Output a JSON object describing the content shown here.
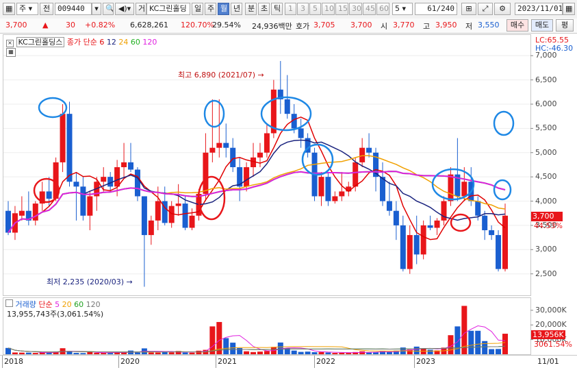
{
  "toolbar": {
    "type_select": "주",
    "prev_label": "전",
    "code_value": "009440",
    "order_btn": "거",
    "stock_name": "KC그린홀딩",
    "period_tabs": [
      "일",
      "주",
      "월",
      "년",
      "분",
      "초",
      "틱"
    ],
    "selected_period": "월",
    "interval_buttons": [
      "1",
      "3",
      "5",
      "10",
      "15",
      "30",
      "45",
      "60"
    ],
    "interval_select": "5",
    "count_current": "61",
    "count_total": "/240",
    "date_value": "2023/11/01"
  },
  "quote": {
    "price": "3,700",
    "change": "30",
    "change_pct": "+0.82%",
    "volume": "6,628,261",
    "vol_ratio": "120.70%",
    "turnover": "29.54%",
    "amount": "24,936백만",
    "bid_label": "호가",
    "bid1": "3,705",
    "bid2": "3,700",
    "open_label": "시",
    "open": "3,770",
    "high_label": "고",
    "high": "3,950",
    "low_label": "저",
    "low": "3,550",
    "buy_btn": "매수",
    "sell_btn": "매도",
    "eval_btn": "평"
  },
  "legend": {
    "name": "KC그린홀딩스",
    "ma_label": "종가 단순",
    "ma_periods": [
      "6",
      "12",
      "24",
      "60",
      "120"
    ],
    "lc": "LC:65.55",
    "hc": "HC:-46.30"
  },
  "annotations": {
    "high": "최고 6,890 (2021/07)",
    "low": "최저 2,235 (2020/03)",
    "last_price": "3,700",
    "last_pct": "44.53%"
  },
  "price_axis": [
    "7,000",
    "6,500",
    "6,000",
    "5,500",
    "5,000",
    "4,500",
    "4,000",
    "3,500",
    "3,000",
    "2,500"
  ],
  "volume_panel": {
    "title": "거래량",
    "ma_label": "단순",
    "ma_periods": [
      "5",
      "20",
      "60",
      "120"
    ],
    "info": "13,955,743주(3,061.54%)",
    "axis": [
      "30,000K",
      "20,000K",
      "10,000K"
    ],
    "last": "13,956K",
    "last_pct": "3061.54%"
  },
  "time_axis": [
    "2018",
    "2020",
    "2021",
    "2022",
    "2023",
    "11/01"
  ],
  "colors": {
    "up": "#e8161a",
    "down": "#1a5fd0",
    "ma6": "#e00000",
    "ma12": "#1a237e",
    "ma24": "#f0a000",
    "ma60": "#20d020",
    "ma120": "#e020e0",
    "marker_blue": "#1e88e5",
    "marker_red": "#e8161a"
  },
  "chart_data": {
    "type": "candlestick",
    "interval": "monthly",
    "y_unit": "KRW",
    "ylim": [
      2100,
      7300
    ],
    "candles": [
      {
        "d": "2017-06",
        "o": 3800,
        "h": 4000,
        "l": 3300,
        "c": 3350
      },
      {
        "d": "2017-07",
        "o": 3350,
        "h": 3900,
        "l": 3200,
        "c": 3750
      },
      {
        "d": "2017-08",
        "o": 3700,
        "h": 4100,
        "l": 3600,
        "c": 3800
      },
      {
        "d": "2017-09",
        "o": 3800,
        "h": 4200,
        "l": 3500,
        "c": 3600
      },
      {
        "d": "2017-10",
        "o": 3600,
        "h": 4000,
        "l": 3500,
        "c": 3950
      },
      {
        "d": "2017-11",
        "o": 3950,
        "h": 4400,
        "l": 3800,
        "c": 4200
      },
      {
        "d": "2017-12",
        "o": 4200,
        "h": 4500,
        "l": 3900,
        "c": 4050
      },
      {
        "d": "2018-01",
        "o": 4050,
        "h": 4900,
        "l": 4000,
        "c": 4800
      },
      {
        "d": "2018-02",
        "o": 4800,
        "h": 6000,
        "l": 4600,
        "c": 5800
      },
      {
        "d": "2018-03",
        "o": 5800,
        "h": 6050,
        "l": 4300,
        "c": 4400
      },
      {
        "d": "2018-04",
        "o": 4400,
        "h": 4600,
        "l": 3600,
        "c": 4300
      },
      {
        "d": "2018-05",
        "o": 4300,
        "h": 4500,
        "l": 3600,
        "c": 3700
      },
      {
        "d": "2018-06",
        "o": 3700,
        "h": 4200,
        "l": 3400,
        "c": 4100
      },
      {
        "d": "2018-07",
        "o": 4100,
        "h": 4500,
        "l": 3800,
        "c": 4400
      },
      {
        "d": "2018-08",
        "o": 4400,
        "h": 4700,
        "l": 4200,
        "c": 4500
      },
      {
        "d": "2018-09",
        "o": 4500,
        "h": 4600,
        "l": 4200,
        "c": 4300
      },
      {
        "d": "2018-10",
        "o": 4300,
        "h": 4850,
        "l": 4100,
        "c": 4700
      },
      {
        "d": "2018-11",
        "o": 4700,
        "h": 5200,
        "l": 4500,
        "c": 4800
      },
      {
        "d": "2018-12",
        "o": 4800,
        "h": 5200,
        "l": 4600,
        "c": 4650
      },
      {
        "d": "2019-01",
        "o": 4650,
        "h": 4700,
        "l": 4000,
        "c": 4100
      },
      {
        "d": "2019-02",
        "o": 4100,
        "h": 4100,
        "l": 2235,
        "c": 3300
      },
      {
        "d": "2019-03",
        "o": 3300,
        "h": 3700,
        "l": 3100,
        "c": 3600
      },
      {
        "d": "2019-04",
        "o": 3600,
        "h": 4300,
        "l": 3400,
        "c": 4000
      },
      {
        "d": "2019-05",
        "o": 4000,
        "h": 4300,
        "l": 3500,
        "c": 3550
      },
      {
        "d": "2019-06",
        "o": 3550,
        "h": 4000,
        "l": 3450,
        "c": 3900
      },
      {
        "d": "2019-07",
        "o": 3900,
        "h": 4350,
        "l": 3700,
        "c": 3950
      },
      {
        "d": "2019-08",
        "o": 3950,
        "h": 4100,
        "l": 3400,
        "c": 3450
      },
      {
        "d": "2019-09",
        "o": 3450,
        "h": 3850,
        "l": 3400,
        "c": 3700
      },
      {
        "d": "2019-10",
        "o": 3700,
        "h": 4250,
        "l": 3600,
        "c": 4150
      },
      {
        "d": "2019-11",
        "o": 4150,
        "h": 5400,
        "l": 4000,
        "c": 5000
      },
      {
        "d": "2019-12",
        "o": 5000,
        "h": 6100,
        "l": 4800,
        "c": 5100
      },
      {
        "d": "2019-13",
        "o": 5100,
        "h": 6100,
        "l": 4900,
        "c": 5200
      },
      {
        "d": "2020-01",
        "o": 5200,
        "h": 5600,
        "l": 4900,
        "c": 5100
      },
      {
        "d": "2020-02",
        "o": 5100,
        "h": 5300,
        "l": 4600,
        "c": 4700
      },
      {
        "d": "2020-03",
        "o": 4700,
        "h": 4900,
        "l": 4000,
        "c": 4300
      },
      {
        "d": "2020-04",
        "o": 4300,
        "h": 4800,
        "l": 4200,
        "c": 4700
      },
      {
        "d": "2020-05",
        "o": 4700,
        "h": 5200,
        "l": 4500,
        "c": 4900
      },
      {
        "d": "2020-06",
        "o": 4900,
        "h": 5200,
        "l": 4700,
        "c": 5000
      },
      {
        "d": "2020-07",
        "o": 5000,
        "h": 5600,
        "l": 4900,
        "c": 5400
      },
      {
        "d": "2020-08",
        "o": 5400,
        "h": 6500,
        "l": 5300,
        "c": 6300
      },
      {
        "d": "2020-09",
        "o": 6300,
        "h": 6890,
        "l": 5800,
        "c": 6100
      },
      {
        "d": "2020-10",
        "o": 6100,
        "h": 6600,
        "l": 5700,
        "c": 5800
      },
      {
        "d": "2020-11",
        "o": 5800,
        "h": 6000,
        "l": 5400,
        "c": 5500
      },
      {
        "d": "2020-12",
        "o": 5500,
        "h": 5700,
        "l": 5100,
        "c": 5300
      },
      {
        "d": "2021-01",
        "o": 5300,
        "h": 5400,
        "l": 4900,
        "c": 5000
      },
      {
        "d": "2021-02",
        "o": 5000,
        "h": 5100,
        "l": 4000,
        "c": 4100
      },
      {
        "d": "2021-03",
        "o": 4100,
        "h": 4600,
        "l": 3900,
        "c": 4500
      },
      {
        "d": "2021-04",
        "o": 4500,
        "h": 4600,
        "l": 3900,
        "c": 4000
      },
      {
        "d": "2021-05",
        "o": 4000,
        "h": 4200,
        "l": 3950,
        "c": 4100
      },
      {
        "d": "2021-06",
        "o": 4100,
        "h": 4600,
        "l": 4000,
        "c": 4200
      },
      {
        "d": "2021-07",
        "o": 4200,
        "h": 4400,
        "l": 4100,
        "c": 4300
      },
      {
        "d": "2021-08",
        "o": 4300,
        "h": 4900,
        "l": 4200,
        "c": 4800
      },
      {
        "d": "2021-09",
        "o": 4800,
        "h": 5300,
        "l": 4700,
        "c": 5100
      },
      {
        "d": "2021-10",
        "o": 5100,
        "h": 5400,
        "l": 4900,
        "c": 5000
      },
      {
        "d": "2021-11",
        "o": 5000,
        "h": 5100,
        "l": 4200,
        "c": 4500
      },
      {
        "d": "2021-12",
        "o": 4500,
        "h": 4800,
        "l": 3900,
        "c": 4000
      },
      {
        "d": "2022-01",
        "o": 4000,
        "h": 4400,
        "l": 3700,
        "c": 3800
      },
      {
        "d": "2022-02",
        "o": 3800,
        "h": 4000,
        "l": 3200,
        "c": 3500
      },
      {
        "d": "2022-03",
        "o": 3500,
        "h": 3700,
        "l": 2550,
        "c": 2600
      },
      {
        "d": "2022-04",
        "o": 2600,
        "h": 3500,
        "l": 2500,
        "c": 3300
      },
      {
        "d": "2022-05",
        "o": 3300,
        "h": 3700,
        "l": 2700,
        "c": 2900
      },
      {
        "d": "2022-06",
        "o": 2900,
        "h": 3600,
        "l": 2800,
        "c": 3500
      },
      {
        "d": "2022-07",
        "o": 3500,
        "h": 3700,
        "l": 3400,
        "c": 3450
      },
      {
        "d": "2022-08",
        "o": 3450,
        "h": 3650,
        "l": 3300,
        "c": 3600
      },
      {
        "d": "2022-09",
        "o": 3600,
        "h": 4100,
        "l": 3500,
        "c": 4000
      },
      {
        "d": "2022-10",
        "o": 4000,
        "h": 4700,
        "l": 3900,
        "c": 4550
      },
      {
        "d": "2022-11",
        "o": 4550,
        "h": 5300,
        "l": 4000,
        "c": 4100
      },
      {
        "d": "2022-12",
        "o": 4100,
        "h": 4700,
        "l": 4000,
        "c": 4400
      },
      {
        "d": "2023-01",
        "o": 4400,
        "h": 4700,
        "l": 3900,
        "c": 4000
      },
      {
        "d": "2023-02",
        "o": 4000,
        "h": 4100,
        "l": 3600,
        "c": 3700
      },
      {
        "d": "2023-03",
        "o": 3700,
        "h": 3800,
        "l": 3200,
        "c": 3400
      },
      {
        "d": "2023-04",
        "o": 3400,
        "h": 3500,
        "l": 3200,
        "c": 3300
      },
      {
        "d": "2023-05",
        "o": 3300,
        "h": 3400,
        "l": 2550,
        "c": 2600
      },
      {
        "d": "2023-06",
        "o": 2600,
        "h": 3950,
        "l": 2550,
        "c": 3700
      }
    ],
    "volume_k": [
      4300,
      1200,
      1100,
      1100,
      900,
      1300,
      1100,
      1900,
      4100,
      2000,
      900,
      800,
      1500,
      1000,
      1000,
      900,
      1600,
      1200,
      2500,
      1200,
      4000,
      1200,
      1200,
      1700,
      1300,
      2200,
      1200,
      1100,
      2400,
      3000,
      19000,
      22000,
      11000,
      7900,
      4200,
      2000,
      1500,
      1800,
      2200,
      5000,
      8000,
      4200,
      2500,
      1600,
      1800,
      1400,
      1500,
      1200,
      900,
      1000,
      900,
      1500,
      2000,
      1200,
      1500,
      2100,
      1600,
      2500,
      4600,
      3200,
      5200,
      4000,
      3100,
      2600,
      4500,
      13000,
      19000,
      33000,
      16000,
      16000,
      9000,
      3500,
      3600,
      14000
    ],
    "series": [
      {
        "name": "6"
      },
      {
        "name": "12"
      },
      {
        "name": "24"
      },
      {
        "name": "60"
      },
      {
        "name": "120"
      }
    ]
  }
}
